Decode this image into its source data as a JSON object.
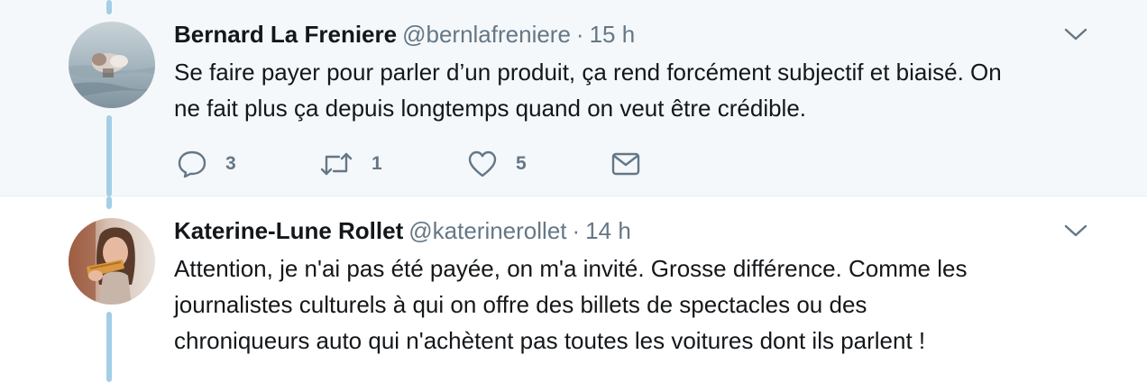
{
  "tweets": [
    {
      "name": "Bernard La Freniere",
      "handle": "@bernlafreniere",
      "separator": "·",
      "time": "15 h",
      "text_lines": [
        "Se faire payer pour parler d’un produit, ça rend forcément subjectif et biaisé. On",
        "ne fait plus ça depuis longtemps quand on veut être crédible."
      ],
      "replies": "3",
      "retweets": "1",
      "likes": "5"
    },
    {
      "name": "Katerine-Lune Rollet",
      "handle": "@katerinerollet",
      "separator": "·",
      "time": "14 h",
      "text_lines": [
        "Attention, je n'ai pas été payée, on m'a invité. Grosse différence.  Comme les",
        "journalistes culturels à qui on offre des billets de  spectacles ou des",
        "chroniqueurs auto qui n'achètent pas toutes les  voitures dont ils parlent !"
      ]
    }
  ],
  "colors": {
    "thread_line": "#a3cfe6",
    "secondary_text": "#657786",
    "highlight_background": "#f5f8fa"
  },
  "icons": {
    "reply": "reply-icon",
    "retweet": "retweet-icon",
    "like": "heart-icon",
    "dm": "envelope-icon",
    "menu": "chevron-down-icon"
  }
}
